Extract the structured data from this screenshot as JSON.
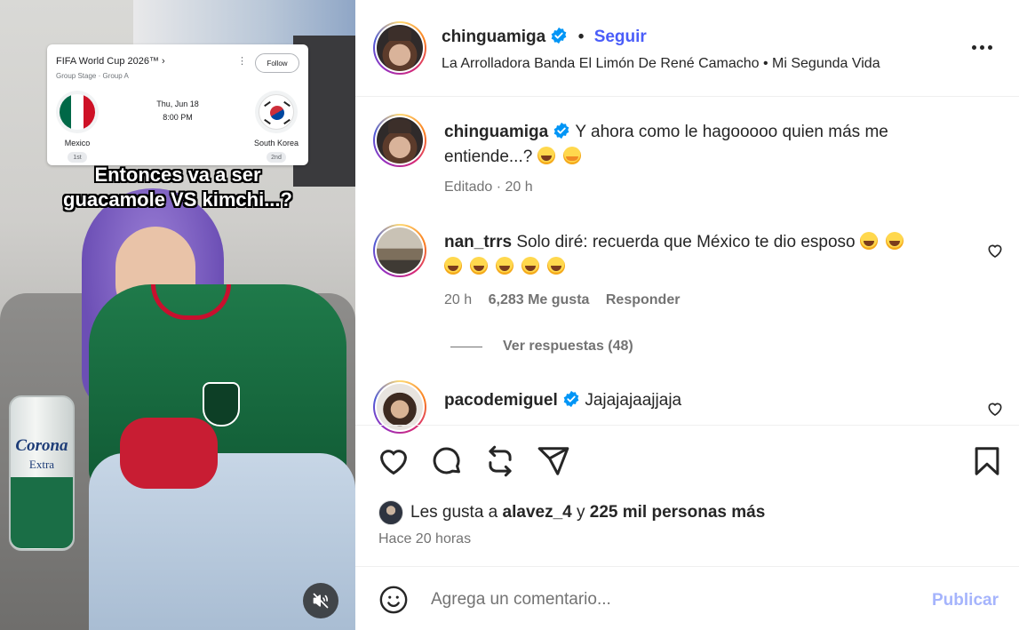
{
  "media": {
    "fifa_card": {
      "title": "FIFA World Cup 2026™ ›",
      "subtitle": "Group Stage · Group A",
      "follow_label": "Follow",
      "date": "Thu, Jun 18",
      "time": "8:00 PM",
      "team_home": "Mexico",
      "team_home_rank": "1st",
      "team_away": "South Korea",
      "team_away_rank": "2nd"
    },
    "caption_line1": "Entonces va a ser",
    "caption_line2": "guacamole VS kimchi...?",
    "can_brand": "Corona",
    "can_sub": "Extra",
    "mute_icon": "muted-speaker-icon"
  },
  "header": {
    "username": "chinguamiga",
    "follow_label": "Seguir",
    "audio": "La Arrolladora Banda El Limón De René Camacho • Mi Segunda Vida"
  },
  "caption": {
    "username": "chinguamiga",
    "text": "Y ahora como le hagooooo quien más me entiende...?",
    "meta": "Editado · 20 h"
  },
  "comments": [
    {
      "username": "nan_trrs",
      "text": "Solo diré: recuerda que México te dio esposo",
      "time": "20 h",
      "likes": "6,283 Me gusta",
      "reply_label": "Responder",
      "view_replies": "Ver respuestas (48)"
    },
    {
      "username": "pacodemiguel",
      "text": "Jajajajaajjaja"
    }
  ],
  "actions": {
    "likes_prefix": "Les gusta a",
    "likes_user": "alavez_4",
    "likes_joiner": "y",
    "likes_rest": "225 mil personas más",
    "posted": "Hace 20 horas"
  },
  "comment_bar": {
    "placeholder": "Agrega un comentario...",
    "publish_label": "Publicar"
  },
  "colors": {
    "link_blue": "#4a5df9",
    "verified_blue": "#0095f6",
    "publish_disabled": "#a5b4fc"
  }
}
